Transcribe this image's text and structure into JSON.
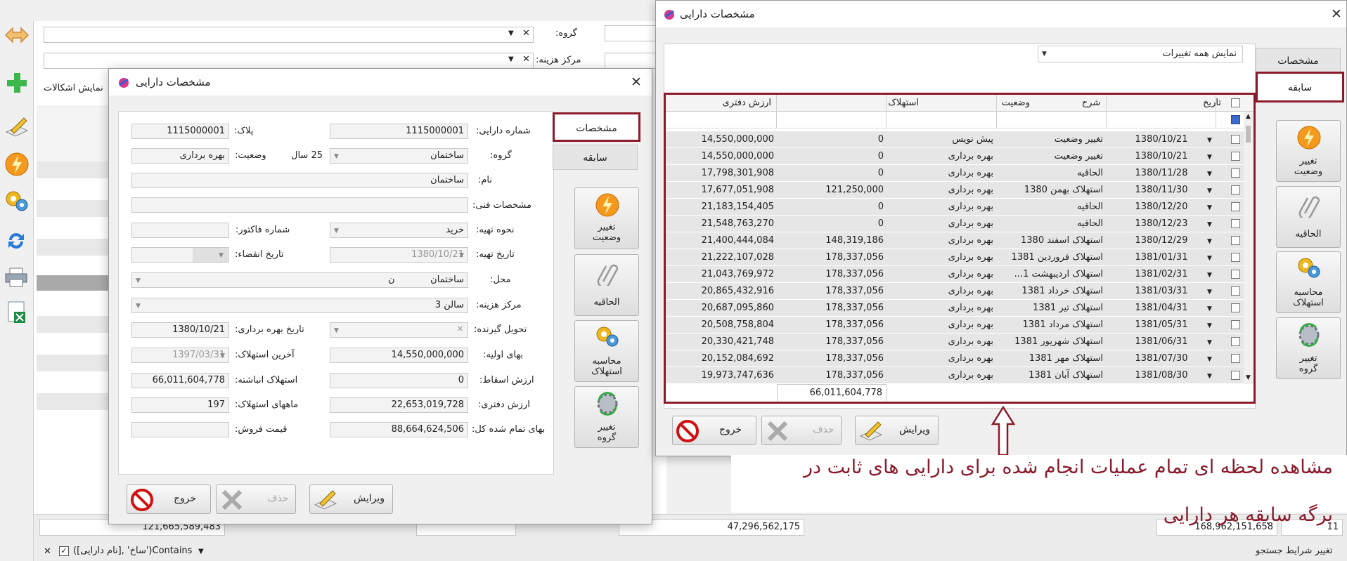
{
  "background": {
    "group_label": "گروه:",
    "cost_center_label": "مرکز هزینه:",
    "show_issues": "نمایش اشکالات",
    "footer_values": [
      "121,665,589,483",
      "47,296,562,175",
      "168,962,151,658",
      "11"
    ],
    "filter_text": "([نام دارایی], 'ساخ')Contains",
    "change_search": "تغییر شرایط جستجو"
  },
  "left_window": {
    "title": "مشخصات دارایی",
    "tabs": [
      "مشخصات",
      "سابقه"
    ],
    "fields": {
      "asset_no_label": "شماره دارایی:",
      "asset_no": "1115000001",
      "plaque_label": "پلاک:",
      "plaque": "1115000001",
      "group_label": "گروه:",
      "group": "ساختمان",
      "years": "25 سال",
      "status_label": "وضعیت:",
      "status": "بهره برداری",
      "name_label": "نام:",
      "name": "ساختمان",
      "tech_label": "مشخصات فنی:",
      "supply_method_label": "نحوه تهیه:",
      "supply_method": "خرید",
      "invoice_label": "شماره فاکتور:",
      "supply_date_label": "تاریخ تهیه:",
      "supply_date": "1380/10/21",
      "expire_label": "تاریخ انقضاء:",
      "location_label": "محل:",
      "location": "ساختمان",
      "location_suffix": "ن",
      "cost_center_label": "مرکز هزینه:",
      "cost_center": "سالن 3",
      "receiver_label": "تحویل گیرنده:",
      "operation_date_label": "تاریخ بهره برداری:",
      "operation_date": "1380/10/21",
      "initial_price_label": "بهای اولیه:",
      "initial_price": "14,550,000,000",
      "last_dep_label": "آخرین استهلاک:",
      "last_dep": "1397/03/31",
      "salvage_label": "ارزش اسقاط:",
      "salvage": "0",
      "acc_dep_label": "استهلاک انباشته:",
      "acc_dep": "66,011,604,778",
      "book_value_label": "ارزش دفتری:",
      "book_value": "22,653,019,728",
      "dep_months_label": "ماههای استهلاک:",
      "dep_months": "197",
      "total_cost_label": "بهای تمام شده کل:",
      "total_cost": "88,664,624,506",
      "sale_price_label": "قیمت فروش:"
    },
    "side_buttons": [
      "تغییر وضعیت",
      "الحاقیه",
      "محاسبه استهلاک",
      "تغییر گروه"
    ],
    "bottom_buttons": {
      "edit": "ویرایش",
      "delete": "حذف",
      "exit": "خروج"
    }
  },
  "right_window": {
    "title": "مشخصات دارایی",
    "tabs": [
      "مشخصات",
      "سابقه"
    ],
    "filter_dropdown": "نمایش همه تغییرات",
    "columns": {
      "date": "تاریخ",
      "desc": "شرح",
      "status": "وضعیت",
      "dep": "استهلاک",
      "book": "ارزش دفتری"
    },
    "rows": [
      {
        "date": "1380/10/21",
        "desc": "تغییر وضعیت",
        "status": "پیش نویس",
        "dep": "0",
        "book": "14,550,000,000"
      },
      {
        "date": "1380/10/21",
        "desc": "تغییر وضعیت",
        "status": "بهره برداری",
        "dep": "0",
        "book": "14,550,000,000"
      },
      {
        "date": "1380/11/28",
        "desc": "الحاقیه",
        "status": "بهره برداری",
        "dep": "0",
        "book": "17,798,301,908"
      },
      {
        "date": "1380/11/30",
        "desc": "استهلاک بهمن 1380",
        "status": "بهره برداری",
        "dep": "121,250,000",
        "book": "17,677,051,908"
      },
      {
        "date": "1380/12/20",
        "desc": "الحاقیه",
        "status": "بهره برداری",
        "dep": "0",
        "book": "21,183,154,405"
      },
      {
        "date": "1380/12/23",
        "desc": "الحاقیه",
        "status": "بهره برداری",
        "dep": "0",
        "book": "21,548,763,270"
      },
      {
        "date": "1380/12/29",
        "desc": "استهلاک اسفند 1380",
        "status": "بهره برداری",
        "dep": "148,319,186",
        "book": "21,400,444,084"
      },
      {
        "date": "1381/01/31",
        "desc": "استهلاک فروردین 1381",
        "status": "بهره برداری",
        "dep": "178,337,056",
        "book": "21,222,107,028"
      },
      {
        "date": "1381/02/31",
        "desc": "استهلاک اردیبهشت 1...",
        "status": "بهره برداری",
        "dep": "178,337,056",
        "book": "21,043,769,972"
      },
      {
        "date": "1381/03/31",
        "desc": "استهلاک خرداد 1381",
        "status": "بهره برداری",
        "dep": "178,337,056",
        "book": "20,865,432,916"
      },
      {
        "date": "1381/04/31",
        "desc": "استهلاک تیر 1381",
        "status": "بهره برداری",
        "dep": "178,337,056",
        "book": "20,687,095,860"
      },
      {
        "date": "1381/05/31",
        "desc": "استهلاک مرداد 1381",
        "status": "بهره برداری",
        "dep": "178,337,056",
        "book": "20,508,758,804"
      },
      {
        "date": "1381/06/31",
        "desc": "استهلاک شهریور 1381",
        "status": "بهره برداری",
        "dep": "178,337,056",
        "book": "20,330,421,748"
      },
      {
        "date": "1381/07/30",
        "desc": "استهلاک مهر 1381",
        "status": "بهره برداری",
        "dep": "178,337,056",
        "book": "20,152,084,692"
      },
      {
        "date": "1381/08/30",
        "desc": "استهلاک آبان 1381",
        "status": "بهره برداری",
        "dep": "178,337,056",
        "book": "19,973,747,636"
      }
    ],
    "dep_total": "66,011,604,778",
    "side_buttons": [
      "تغییر وضعیت",
      "الحاقیه",
      "محاسبه استهلاک",
      "تغییر گروه"
    ],
    "bottom_buttons": {
      "edit": "ویرایش",
      "delete": "حذف",
      "exit": "خروج"
    }
  },
  "annotation": {
    "line1": "مشاهده لحظه ای تمام عملیات انجام شده برای دارایی های ثابت در",
    "line2": "برگه سابقه هر دارایی",
    "color": "#8b1a2b"
  }
}
